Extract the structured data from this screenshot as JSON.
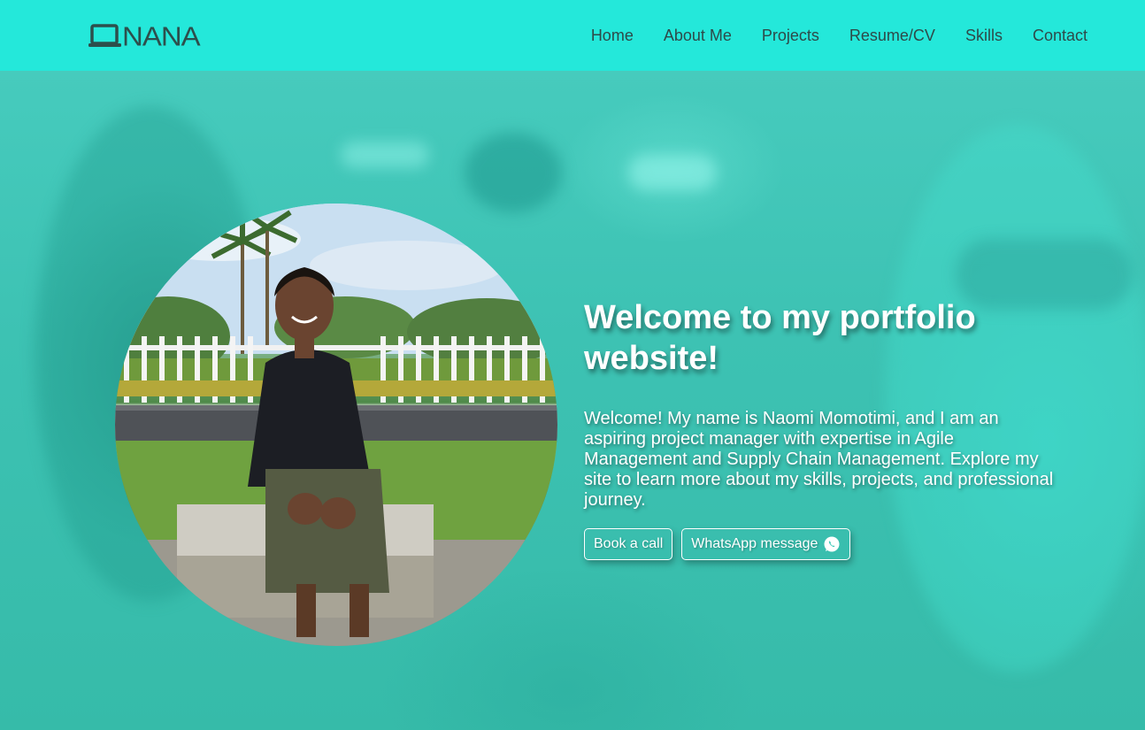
{
  "header": {
    "logo_text": "NANA",
    "nav": [
      {
        "label": "Home"
      },
      {
        "label": "About Me"
      },
      {
        "label": "Projects"
      },
      {
        "label": "Resume/CV"
      },
      {
        "label": "Skills"
      },
      {
        "label": "Contact"
      }
    ]
  },
  "hero": {
    "title": "Welcome to my portfolio website!",
    "description": "Welcome! My name is Naomi Momotimi, and I am an aspiring project manager with expertise in Agile Management and Supply Chain Management. Explore my site to learn more about my skills, projects, and professional journey.",
    "buttons": {
      "book_call": "Book a call",
      "whatsapp": "WhatsApp message"
    },
    "profile_photo_alt": "profile photo"
  },
  "colors": {
    "header_bg": "#24e8da",
    "nav_text": "#2e4a49",
    "hero_overlay": "#3ec9b8",
    "text_light": "#ffffff"
  },
  "icons": {
    "logo": "laptop-icon",
    "whatsapp": "whatsapp-icon"
  }
}
